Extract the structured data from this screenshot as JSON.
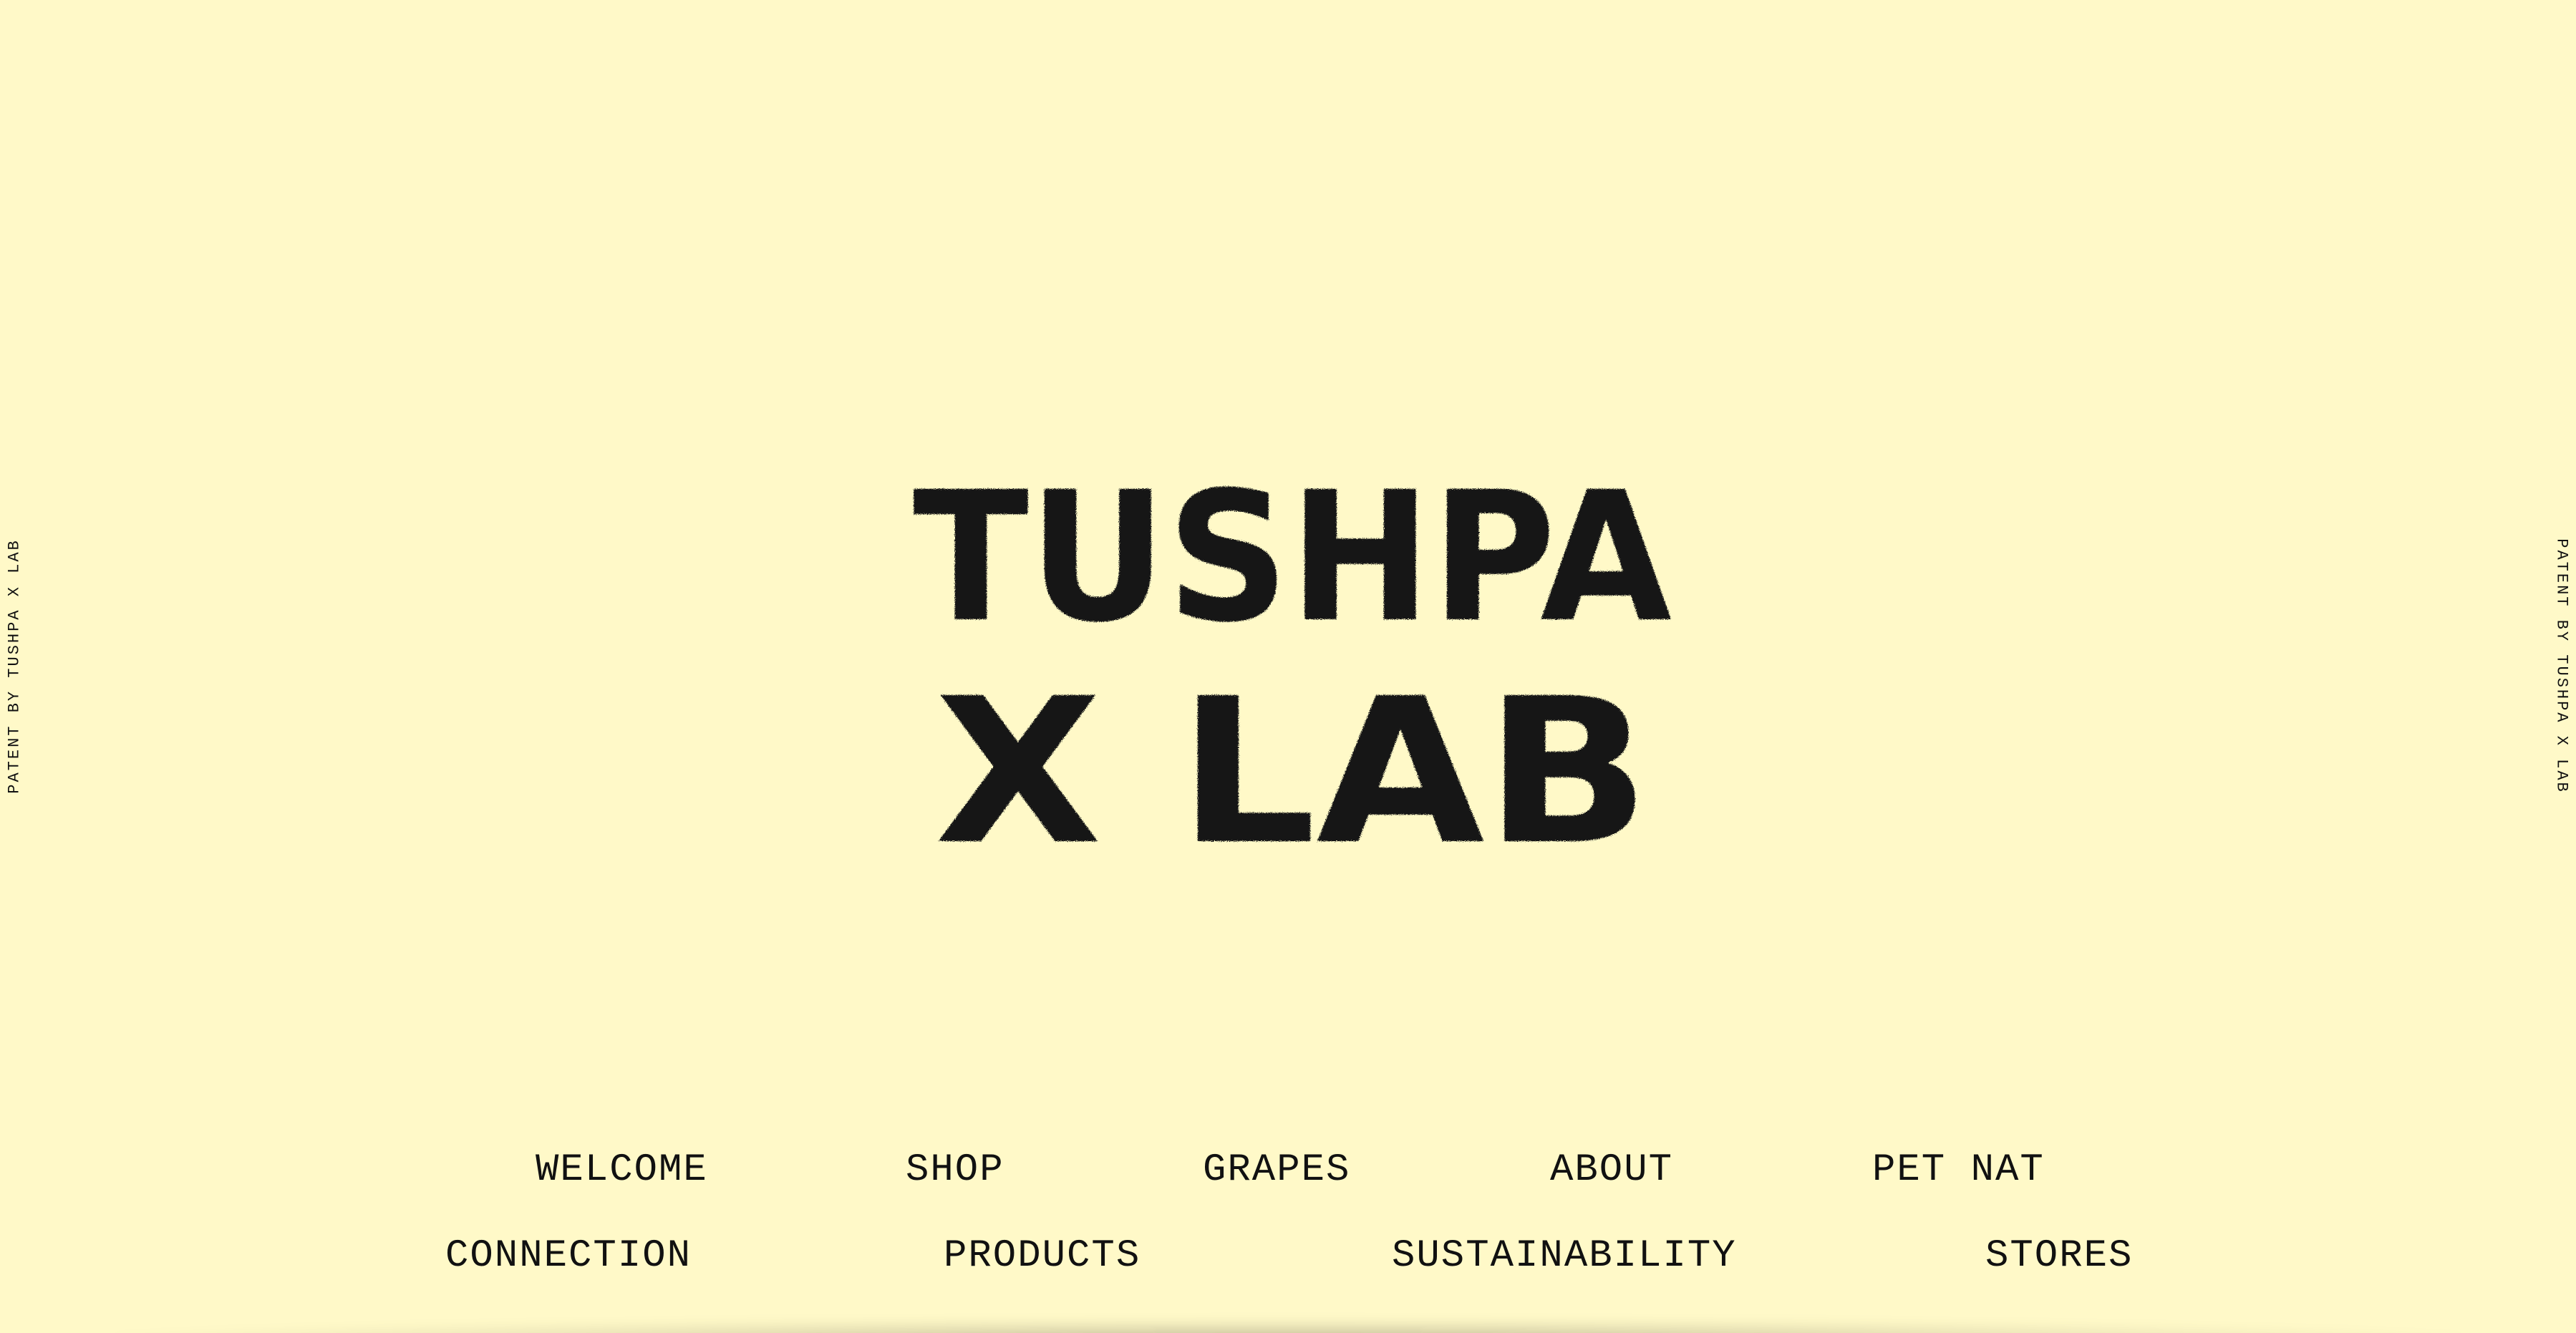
{
  "side_label_left": "PATENT BY TUSHPA X LAB",
  "side_label_right": "PATENT BY TUSHPA X LAB",
  "logo": {
    "line1": "TUSHPA",
    "line2": "X LAB"
  },
  "nav": {
    "row1": [
      "WELCOME",
      "SHOP",
      "GRAPES",
      "ABOUT",
      "PET NAT"
    ],
    "row2": [
      "CONNECTION",
      "PRODUCTS",
      "SUSTAINABILITY",
      "STORES"
    ]
  },
  "colors": {
    "background": "#fff9c8",
    "text": "#111111"
  }
}
